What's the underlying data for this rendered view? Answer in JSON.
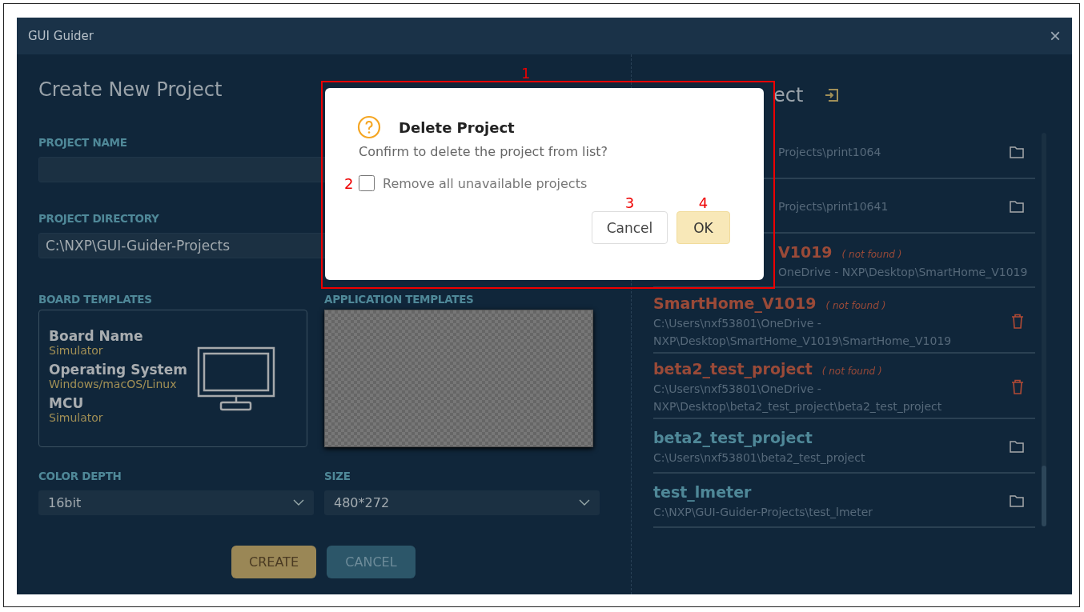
{
  "window": {
    "title": "GUI Guider",
    "close": "×"
  },
  "create": {
    "title": "Create New Project",
    "project_name_label": "PROJECT NAME",
    "project_directory_label": "PROJECT DIRECTORY",
    "project_directory": "C:\\NXP\\GUI-Guider-Projects",
    "board_templates_label": "BOARD TEMPLATES",
    "application_templates_label": "APPLICATION TEMPLATES",
    "board": [
      {
        "label": "Board Name",
        "value": "Simulator"
      },
      {
        "label": "Operating System",
        "value": "Windows/macOS/Linux"
      },
      {
        "label": "MCU",
        "value": "Simulator"
      }
    ],
    "color_depth_label": "COLOR DEPTH",
    "color_depth": "16bit",
    "size_label": "SIZE",
    "size": "480*272",
    "create_button": "CREATE",
    "cancel_button": "CANCEL"
  },
  "open": {
    "title": "ect",
    "projects": [
      {
        "partial": true,
        "missing": false,
        "path": [
          "Projects\\print1064"
        ]
      },
      {
        "partial": true,
        "missing": false,
        "path": [
          "Projects\\print10641"
        ]
      },
      {
        "partial": true,
        "missing": true,
        "name": "V1019",
        "note": "( not found )",
        "path": [
          "OneDrive - NXP\\Desktop\\SmartHome_V1019"
        ]
      },
      {
        "partial": false,
        "missing": true,
        "name": "SmartHome_V1019",
        "note": "( not found )",
        "path": [
          "C:\\Users\\nxf53801\\OneDrive -",
          "NXP\\Desktop\\SmartHome_V1019\\SmartHome_V1019"
        ]
      },
      {
        "partial": false,
        "missing": true,
        "name": "beta2_test_project",
        "note": "( not found )",
        "path": [
          "C:\\Users\\nxf53801\\OneDrive -",
          "NXP\\Desktop\\beta2_test_project\\beta2_test_project"
        ]
      },
      {
        "partial": false,
        "missing": false,
        "name": "beta2_test_project",
        "path": [
          "C:\\Users\\nxf53801\\beta2_test_project"
        ]
      },
      {
        "partial": false,
        "missing": false,
        "name": "test_lmeter",
        "path": [
          "C:\\NXP\\GUI-Guider-Projects\\test_lmeter"
        ]
      }
    ]
  },
  "dialog": {
    "title": "Delete Project",
    "message": "Confirm to delete the project from list?",
    "checkbox": {
      "label": "Remove all unavailable projects",
      "checked": false
    },
    "cancel": "Cancel",
    "ok": "OK"
  },
  "annotations": [
    "1",
    "2",
    "3",
    "4"
  ]
}
